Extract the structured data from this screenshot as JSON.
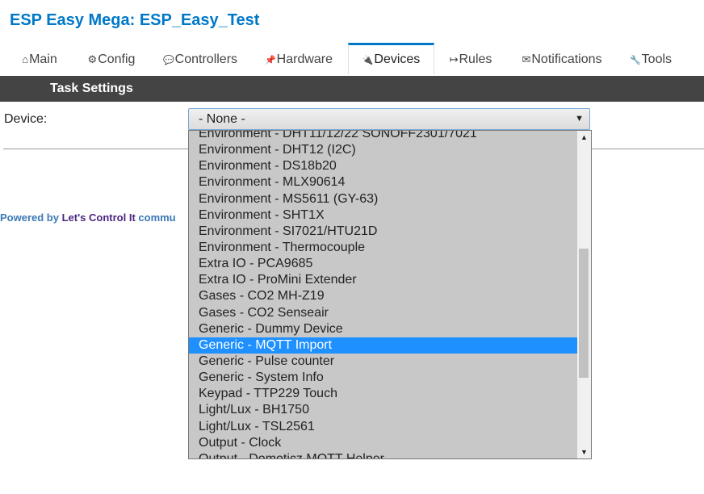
{
  "header": {
    "title": "ESP Easy Mega: ESP_Easy_Test"
  },
  "tabs": [
    {
      "icon": "⌂",
      "label": "Main"
    },
    {
      "icon": "⚙",
      "label": "Config"
    },
    {
      "icon": "💬",
      "label": "Controllers"
    },
    {
      "icon": "📌",
      "label": "Hardware"
    },
    {
      "icon": "🔌",
      "label": "Devices"
    },
    {
      "icon": "↦",
      "label": "Rules"
    },
    {
      "icon": "✉",
      "label": "Notifications"
    },
    {
      "icon": "🔧",
      "label": "Tools"
    }
  ],
  "active_tab": "Devices",
  "task_settings": {
    "heading": "Task Settings"
  },
  "device": {
    "label": "Device:",
    "selected": "- None -",
    "options": [
      "Environment - DHT11/12/22  SONOFF2301/7021",
      "Environment - DHT12 (I2C)",
      "Environment - DS18b20",
      "Environment - MLX90614",
      "Environment - MS5611 (GY-63)",
      "Environment - SHT1X",
      "Environment - SI7021/HTU21D",
      "Environment - Thermocouple",
      "Extra IO - PCA9685",
      "Extra IO - ProMini Extender",
      "Gases - CO2 MH-Z19",
      "Gases - CO2 Senseair",
      "Generic - Dummy Device",
      "Generic - MQTT Import",
      "Generic - Pulse counter",
      "Generic - System Info",
      "Keypad - TTP229 Touch",
      "Light/Lux - BH1750",
      "Light/Lux - TSL2561",
      "Output - Clock",
      "Output - Domoticz MQTT Helper"
    ],
    "highlighted": "Generic - MQTT Import"
  },
  "footer": {
    "powered_prefix": "Powered by ",
    "brand": "Let's Control It",
    "suffix": " commu"
  }
}
